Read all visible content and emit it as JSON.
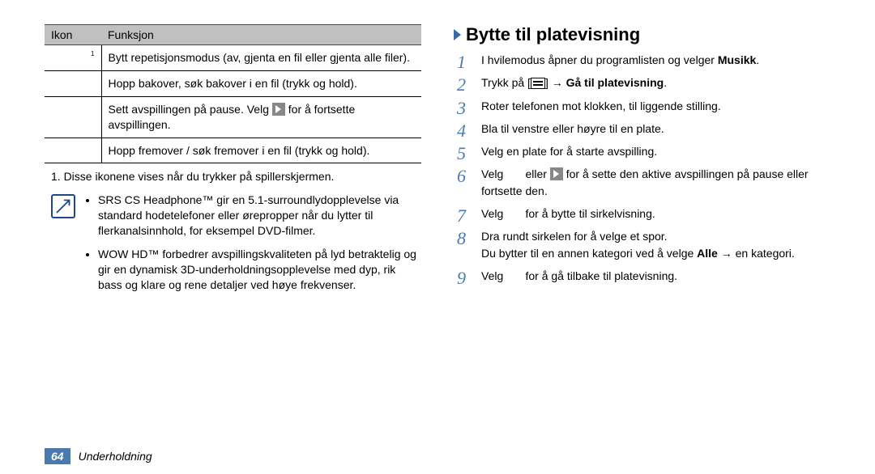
{
  "table": {
    "header": {
      "col1": "Ikon",
      "col2": "Funksjon"
    },
    "rows": [
      {
        "icon": "1",
        "func": "Bytt repetisjonsmodus (av, gjenta en fil eller gjenta alle filer)."
      },
      {
        "icon": "",
        "func": "Hopp bakover, søk bakover i en fil (trykk og hold)."
      },
      {
        "icon": "",
        "func_pre": "Sett avspillingen på pause. Velg ",
        "func_post": " for å fortsette avspillingen."
      },
      {
        "icon": "",
        "func": "Hopp fremover / søk fremover i en fil (trykk og hold)."
      }
    ]
  },
  "footnote": "1. Disse ikonene vises når du trykker på spillerskjermen.",
  "notes": [
    "SRS CS Headphone™ gir en 5.1-surroundlydopplevelse via standard hodetelefoner eller ørepropper når du lytter til flerkanalsinnhold, for eksempel DVD-filmer.",
    "WOW HD™ forbedrer avspillingskvaliteten på lyd betraktelig og gir en dynamisk 3D-underholdningsopplevelse med dyp, rik bass og klare og rene detaljer ved høye frekvenser."
  ],
  "right": {
    "heading": "Bytte til platevisning",
    "steps": {
      "s1_pre": "I hvilemodus åpner du programlisten og velger ",
      "s1_bold": "Musikk",
      "s1_post": ".",
      "s2_pre": "Trykk på [",
      "s2_mid": "] → ",
      "s2_bold": "Gå til platevisning",
      "s2_post": ".",
      "s3": "Roter telefonen mot klokken, til liggende stilling.",
      "s4": "Bla til venstre eller høyre til en plate.",
      "s5": "Velg en plate for å starte avspilling.",
      "s6_pre": "Velg ",
      "s6_mid1": " eller ",
      "s6_post": " for å sette den aktive avspillingen på pause eller fortsette den.",
      "s7_pre": "Velg ",
      "s7_post": " for å bytte til sirkelvisning.",
      "s8_a": "Dra rundt sirkelen for å velge et spor.",
      "s8_b_pre": "Du bytter til en annen kategori ved å velge ",
      "s8_b_bold": "Alle",
      "s8_b_post": " → en kategori.",
      "s9_pre": "Velg ",
      "s9_post": " for å gå tilbake til platevisning."
    }
  },
  "footer": {
    "page": "64",
    "section": "Underholdning"
  }
}
